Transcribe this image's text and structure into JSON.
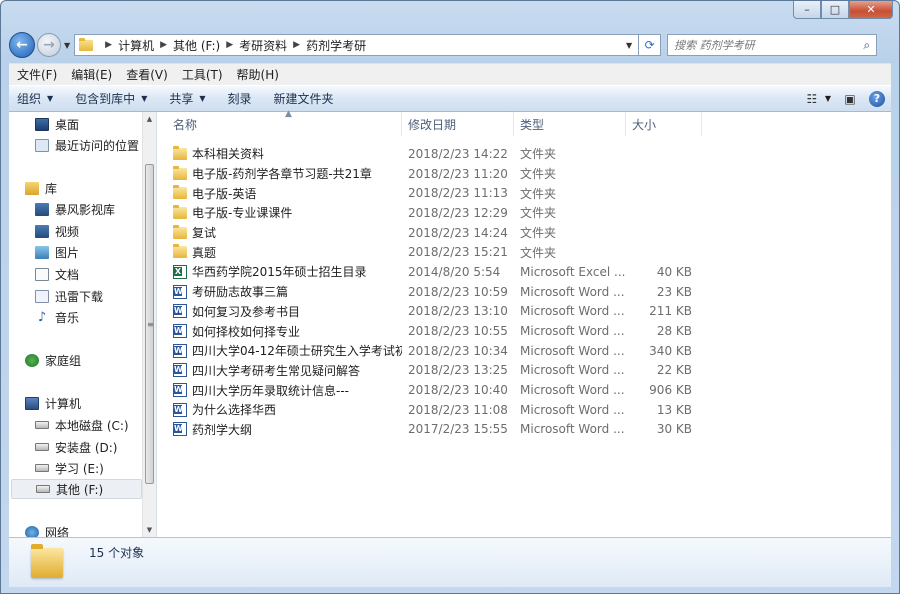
{
  "window": {
    "controls": {
      "minimize": "–",
      "maximize": "□",
      "close": "✕"
    }
  },
  "nav": {
    "back_icon": "back-arrow-icon",
    "forward_icon": "forward-arrow-icon",
    "breadcrumbs": [
      "计算机",
      "其他 (F:)",
      "考研资料",
      "药剂学考研"
    ]
  },
  "search": {
    "placeholder": "搜索 药剂学考研"
  },
  "menubar": [
    "文件(F)",
    "编辑(E)",
    "查看(V)",
    "工具(T)",
    "帮助(H)"
  ],
  "toolbar": {
    "organize": "组织",
    "include_library": "包含到库中",
    "share": "共享",
    "burn": "刻录",
    "new_folder": "新建文件夹"
  },
  "sidebar": {
    "items": [
      {
        "label": "桌面",
        "icon": "desktop-icon"
      },
      {
        "label": "最近访问的位置",
        "icon": "recent-places-icon"
      },
      {
        "label": "库",
        "icon": "library-icon"
      },
      {
        "label": "暴风影视库",
        "icon": "video-library-icon"
      },
      {
        "label": "视频",
        "icon": "video-icon"
      },
      {
        "label": "图片",
        "icon": "picture-icon"
      },
      {
        "label": "文档",
        "icon": "document-icon"
      },
      {
        "label": "迅雷下载",
        "icon": "download-icon"
      },
      {
        "label": "音乐",
        "icon": "music-icon"
      },
      {
        "label": "家庭组",
        "icon": "homegroup-icon"
      },
      {
        "label": "计算机",
        "icon": "computer-icon"
      },
      {
        "label": "本地磁盘 (C:)",
        "icon": "drive-icon"
      },
      {
        "label": "安装盘 (D:)",
        "icon": "drive-icon"
      },
      {
        "label": "学习 (E:)",
        "icon": "drive-icon"
      },
      {
        "label": "其他 (F:)",
        "icon": "drive-icon"
      },
      {
        "label": "网络",
        "icon": "network-icon"
      }
    ]
  },
  "columns": {
    "name": "名称",
    "date": "修改日期",
    "type": "类型",
    "size": "大小"
  },
  "files": [
    {
      "name": "本科相关资料",
      "date": "2018/2/23 14:22",
      "type": "文件夹",
      "size": "",
      "kind": "folder"
    },
    {
      "name": "电子版-药剂学各章节习题-共21章",
      "date": "2018/2/23 11:20",
      "type": "文件夹",
      "size": "",
      "kind": "folder"
    },
    {
      "name": "电子版-英语",
      "date": "2018/2/23 11:13",
      "type": "文件夹",
      "size": "",
      "kind": "folder"
    },
    {
      "name": "电子版-专业课课件",
      "date": "2018/2/23 12:29",
      "type": "文件夹",
      "size": "",
      "kind": "folder"
    },
    {
      "name": "复试",
      "date": "2018/2/23 14:24",
      "type": "文件夹",
      "size": "",
      "kind": "folder"
    },
    {
      "name": "真题",
      "date": "2018/2/23 15:21",
      "type": "文件夹",
      "size": "",
      "kind": "folder"
    },
    {
      "name": "华西药学院2015年硕士招生目录",
      "date": "2014/8/20 5:54",
      "type": "Microsoft Excel ...",
      "size": "40 KB",
      "kind": "excel"
    },
    {
      "name": "考研励志故事三篇",
      "date": "2018/2/23 10:59",
      "type": "Microsoft Word ...",
      "size": "23 KB",
      "kind": "word"
    },
    {
      "name": "如何复习及参考书目",
      "date": "2018/2/23 13:10",
      "type": "Microsoft Word ...",
      "size": "211 KB",
      "kind": "word"
    },
    {
      "name": "如何择校如何择专业",
      "date": "2018/2/23 10:55",
      "type": "Microsoft Word ...",
      "size": "28 KB",
      "kind": "word"
    },
    {
      "name": "四川大学04-12年硕士研究生入学考试初...",
      "date": "2018/2/23 10:34",
      "type": "Microsoft Word ...",
      "size": "340 KB",
      "kind": "word"
    },
    {
      "name": "四川大学考研考生常见疑问解答",
      "date": "2018/2/23 13:25",
      "type": "Microsoft Word ...",
      "size": "22 KB",
      "kind": "word"
    },
    {
      "name": "四川大学历年录取统计信息---",
      "date": "2018/2/23 10:40",
      "type": "Microsoft Word ...",
      "size": "906 KB",
      "kind": "word"
    },
    {
      "name": "为什么选择华西",
      "date": "2018/2/23 11:08",
      "type": "Microsoft Word ...",
      "size": "13 KB",
      "kind": "word"
    },
    {
      "name": "药剂学大纲",
      "date": "2017/2/23 15:55",
      "type": "Microsoft Word ...",
      "size": "30 KB",
      "kind": "word"
    }
  ],
  "status": {
    "count_text": "15 个对象"
  }
}
